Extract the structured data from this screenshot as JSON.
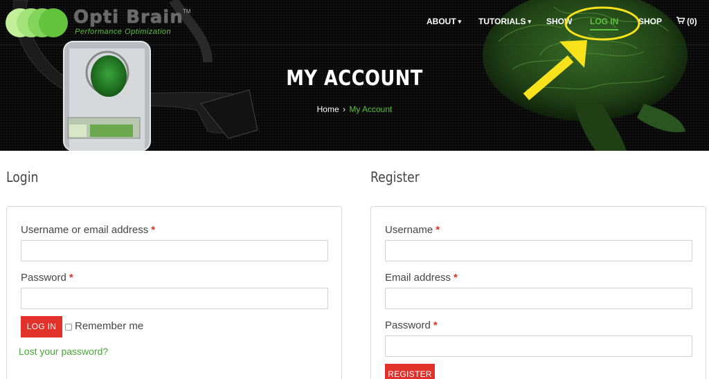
{
  "brand": {
    "name": "Opti Brain",
    "trademark": "TM",
    "tagline": "Performance Optimization",
    "circle_colors": [
      "#c4ef9a",
      "#a4e27a",
      "#83d45a",
      "#62c43d"
    ]
  },
  "nav": {
    "items": [
      {
        "label": "ABOUT",
        "has_dropdown": true
      },
      {
        "label": "TUTORIALS",
        "has_dropdown": true
      },
      {
        "label": "SHOW",
        "has_dropdown": false
      },
      {
        "label": "LOG IN",
        "has_dropdown": false,
        "active": true
      },
      {
        "label": "SHOP",
        "has_dropdown": false
      }
    ],
    "cart_label": "(0)",
    "cart_icon": "cart-icon"
  },
  "hero": {
    "title": "MY ACCOUNT",
    "breadcrumb_home": "Home",
    "breadcrumb_sep": "›",
    "breadcrumb_current": "My Account"
  },
  "login": {
    "heading": "Login",
    "username_label": "Username or email address",
    "password_label": "Password",
    "required_mark": "*",
    "button_label": "LOG IN",
    "remember_label": "Remember me",
    "lost_password": "Lost your password?"
  },
  "register": {
    "heading": "Register",
    "username_label": "Username",
    "email_label": "Email address",
    "password_label": "Password",
    "required_mark": "*",
    "button_label": "REGISTER"
  },
  "colors": {
    "accent_green": "#5cc13e",
    "button_red": "#e2312a",
    "annotation_yellow": "#f7e21b"
  }
}
